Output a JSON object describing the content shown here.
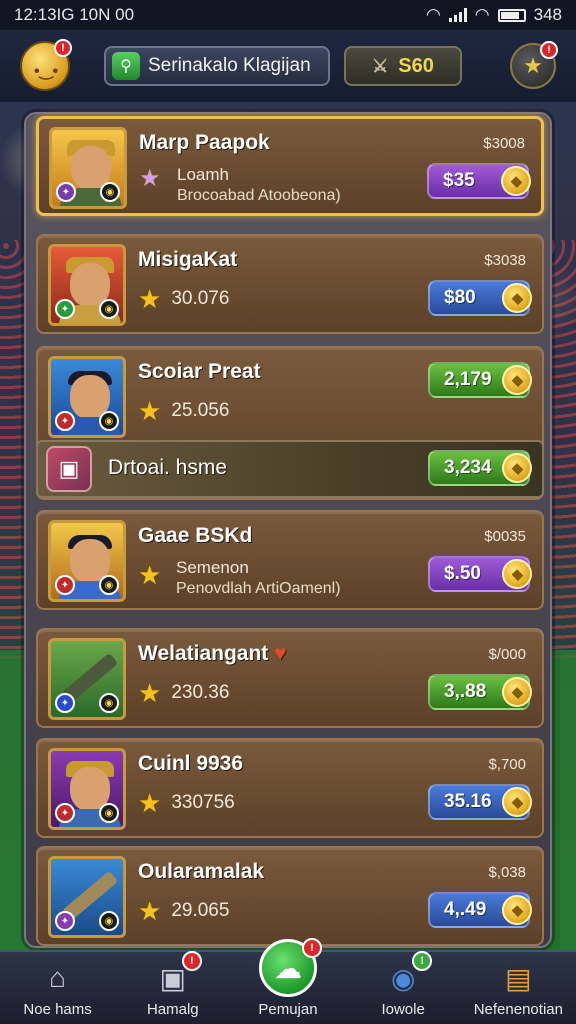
{
  "status_bar": {
    "time": "12:13IG 10N 00",
    "battery": "348"
  },
  "header": {
    "search_text": "Serinakalo Klagijan",
    "coins": "S60",
    "avatar_badge": "!",
    "bell_badge": "!"
  },
  "players": [
    {
      "name": "Marp Paapok",
      "top_price": "$3008",
      "line1": "Loamh",
      "line2": "Brocoabad Atoobeona)",
      "price": "$35",
      "price_color": "purple",
      "star": "pink",
      "badge_color": "#7a3ab0"
    },
    {
      "name": "MisigaKat",
      "top_price": "$3038",
      "stat": "30.076",
      "price": "$80",
      "price_color": "blue",
      "star": "gold",
      "badge_color": "#2a9a3a"
    },
    {
      "name": "Scoiar Preat",
      "top_price": "",
      "stat": "25.056",
      "price": "2,179",
      "price_color": "green",
      "star": "gold",
      "badge_color": "#c02a2a"
    },
    {
      "name": "Gaae BSKd",
      "top_price": "$0035",
      "line1": "Semenon",
      "line2": "Penovdlah ArtiOamenl)",
      "price": "$.50",
      "price_color": "purple",
      "star": "gold",
      "badge_color": "#c02a2a"
    },
    {
      "name": "Welatiangant",
      "top_price": "$/000",
      "stat": "230.36",
      "price": "3,.88",
      "price_color": "green",
      "star": "gold",
      "badge_color": "#2a4ad0"
    },
    {
      "name": "Cuinl 9936",
      "top_price": "$,700",
      "stat": "330756",
      "price": "35.16",
      "price_color": "blue",
      "star": "gold",
      "badge_color": "#c02a2a"
    },
    {
      "name": "Oularamalak",
      "top_price": "$,038",
      "stat": "29.065",
      "price": "4,.49",
      "price_color": "blue",
      "star": "gold",
      "badge_color": "#8a3ab0"
    }
  ],
  "promo": {
    "label": "Drtoai. hsme",
    "price": "3,234"
  },
  "bottom_nav": [
    {
      "label": "Noe hams",
      "icon": "home-icon",
      "badge": ""
    },
    {
      "label": "Hamalg",
      "icon": "camera-icon",
      "badge": "!"
    },
    {
      "label": "Pemujan",
      "icon": "chat-icon",
      "badge": "!",
      "active": true
    },
    {
      "label": "Iowole",
      "icon": "webcam-icon",
      "badge": "!"
    },
    {
      "label": "Nefenenotian",
      "icon": "toolbox-icon",
      "badge": ""
    }
  ],
  "colors": {
    "gold": "#f4c21a",
    "panel_brown": "#6a4a30",
    "accent_green": "#2e9a2e"
  }
}
